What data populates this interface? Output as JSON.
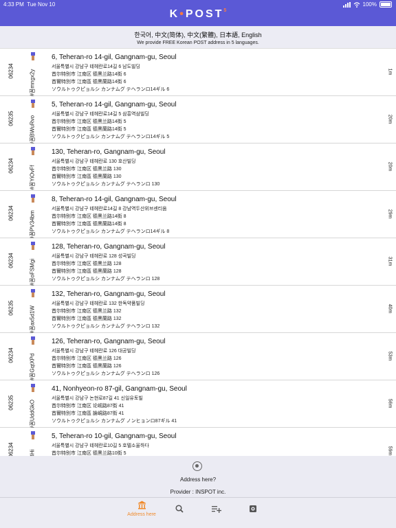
{
  "status_bar": {
    "time": "4:33 PM",
    "date": "Tue Nov 10",
    "battery": "100%"
  },
  "header": {
    "logo_left": "K",
    "logo_right": "POST",
    "logo_sup": "5"
  },
  "subheader": {
    "languages": "한국어, 中文(简体), 中文(繁體), 日本語, English",
    "description": "We provide FREE Korean POST address in 5 languages."
  },
  "colors": {
    "header": "#5b59d6",
    "accent": "#ff7a3d"
  },
  "addresses": [
    {
      "zip": "06234",
      "code": "#꼼mngx2y",
      "title": "6, Teheran-ro 14-gil, Gangnam-gu, Seoul",
      "korean": "서울특별시 강남구 테헤란로14길 6 남도빌딩",
      "simplified": "首尔特别市 江南区 德黑兰路14街 6",
      "traditional": "首爾特別市 江南區 德黑蘭路14街 6",
      "japanese": "ソウルトゥクピョルシ カンナムグ テヘランロ14ギル 6",
      "distance": "1m"
    },
    {
      "zip": "06235",
      "code": "#꼼BWuRvo",
      "title": "5, Teheran-ro 14-gil, Gangnam-gu, Seoul",
      "korean": "서울특별시 강남구 테헤란로14길 5 삼흥역삼빌딩",
      "simplified": "首尔特别市 江南区 德黑兰路14街 5",
      "traditional": "首爾特別市 江南區 德黑蘭路14街 5",
      "japanese": "ソウルトゥクピョルシ カンナムグ テヘランロ14ギル 5",
      "distance": "20m"
    },
    {
      "zip": "06234",
      "code": "#꼼YiOvFf",
      "title": "130, Teheran-ro, Gangnam-gu, Seoul",
      "korean": "서울특별시 강남구 테헤란로 130 호산빌딩",
      "simplified": "首尔特别市 江南区 德黑兰路 130",
      "traditional": "首爾特別市 江南區 德黑蘭路 130",
      "japanese": "ソウルトゥクピョルシ カンナムグ テヘランロ 130",
      "distance": "20m"
    },
    {
      "zip": "06234",
      "code": "#꼼PV34bm",
      "title": "8, Teheran-ro 14-gil, Gangnam-gu, Seoul",
      "korean": "서울특별시 강남구 테헤란로14길 8 강남역두산위브센티움",
      "simplified": "首尔特别市 江南区 德黑兰路14街 8",
      "traditional": "首爾特別市 江南區 德黑蘭路14街 8",
      "japanese": "ソウルトゥクピョルシ カンナムグ テヘランロ14ギル 8",
      "distance": "29m"
    },
    {
      "zip": "06234",
      "code": "#꼼oFSMgi",
      "title": "128, Teheran-ro, Gangnam-gu, Seoul",
      "korean": "서울특별시 강남구 테헤란로 128 성곡빌딩",
      "simplified": "首尔特别市 江南区 德黑兰路 128",
      "traditional": "首爾特別市 江南區 德黑蘭路 128",
      "japanese": "ソウルトゥクピョルシ カンナムグ テヘランロ 128",
      "distance": "31m"
    },
    {
      "zip": "06235",
      "code": "#꼼ax5d1W",
      "title": "132, Teheran-ro, Gangnam-gu, Seoul",
      "korean": "서울특별시 강남구 테헤란로 132 한독약품빌딩",
      "simplified": "首尔特别市 江南区 德黑兰路 132",
      "traditional": "首爾特別市 江南區 德黑蘭路 132",
      "japanese": "ソウルトゥクピョルシ カンナムグ テヘランロ 132",
      "distance": "40m"
    },
    {
      "zip": "06234",
      "code": "#꼼GqtXPd",
      "title": "126, Teheran-ro, Gangnam-gu, Seoul",
      "korean": "서울특별시 강남구 테헤란로 126 대공빌딩",
      "simplified": "首尔特别市 江南区 德黑兰路 126",
      "traditional": "首爾特別市 江南區 德黑蘭路 126",
      "japanese": "ソウルトゥクピョルシ カンナムグ テヘランロ 126",
      "distance": "53m"
    },
    {
      "zip": "06235",
      "code": "#꼼UddGkO",
      "title": "41, Nonhyeon-ro 87-gil, Gangnam-gu, Seoul",
      "korean": "서울특별시 강남구 논현로87길 41 신일유토빌",
      "simplified": "首尔特别市 江南区 论岘路87街 41",
      "traditional": "首爾特別市 江南區 論峴路87街 41",
      "japanese": "ソウルトゥクピョルシ カンナムグ ノンヒョンロ87ギル 41",
      "distance": "56m"
    },
    {
      "zip": "06234",
      "code": "#꼼ZtzBHi",
      "title": "5, Teheran-ro 10-gil, Gangnam-gu, Seoul",
      "korean": "서울특별시 강남구 테헤란로10길 5 호텔소울하다",
      "simplified": "首尔特别市 江南区 德黑兰路10街 5",
      "traditional": "首爾特別市 江南區 德黑蘭路10街 5",
      "japanese": "ソウルトゥクピョルシ カンナムグ テヘランロ10ギル 5",
      "distance": "59m"
    }
  ],
  "footer": {
    "address_here": "Address here?",
    "provider": "Provider : INSPOT inc."
  },
  "tabs": [
    {
      "label": "Address here",
      "icon": "bank-icon",
      "active": true
    },
    {
      "label": "",
      "icon": "search-icon",
      "active": false
    },
    {
      "label": "",
      "icon": "add-list-icon",
      "active": false
    },
    {
      "label": "",
      "icon": "settings-icon",
      "active": false
    }
  ]
}
